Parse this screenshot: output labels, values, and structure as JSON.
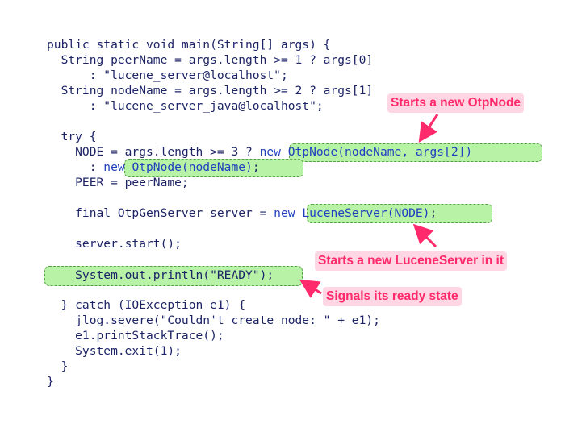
{
  "code": {
    "lines": [
      "public static void main(String[] args) {",
      "  String peerName = args.length >= 1 ? args[0]",
      "      : \"lucene_server@localhost\";",
      "  String nodeName = args.length >= 2 ? args[1]",
      "      : \"lucene_server_java@localhost\";",
      "",
      "  try {",
      "    NODE = args.length >= 3 ? ",
      "      : ",
      "    PEER = peerName;",
      "",
      "    final OtpGenServer server = ",
      "",
      "    server.start();",
      "",
      "    System.out.println(\"READY\");",
      "",
      "  } catch (IOException e1) {",
      "    jlog.severe(\"Couldn't create node: \" + e1);",
      "    e1.printStackTrace();",
      "    System.exit(1);",
      "  }",
      "}"
    ],
    "highlight_1": "new OtpNode(nodeName, args[2])",
    "highlight_2": "new OtpNode(nodeName)",
    "highlight_3": "new LuceneServer(NODE)",
    "suffix_semicolon": ";"
  },
  "callouts": {
    "otpnode": "Starts a new OtpNode",
    "luceneserver": "Starts a new LuceneServer in it",
    "ready": "Signals its ready state"
  },
  "colors": {
    "code_text": "#1d2466",
    "keyword_new": "#1f3fbf",
    "highlight_fill": "#b7f2a6",
    "highlight_border": "#5aa04a",
    "callout_text": "#ff2a6b",
    "callout_fill": "#ffd6e3"
  }
}
